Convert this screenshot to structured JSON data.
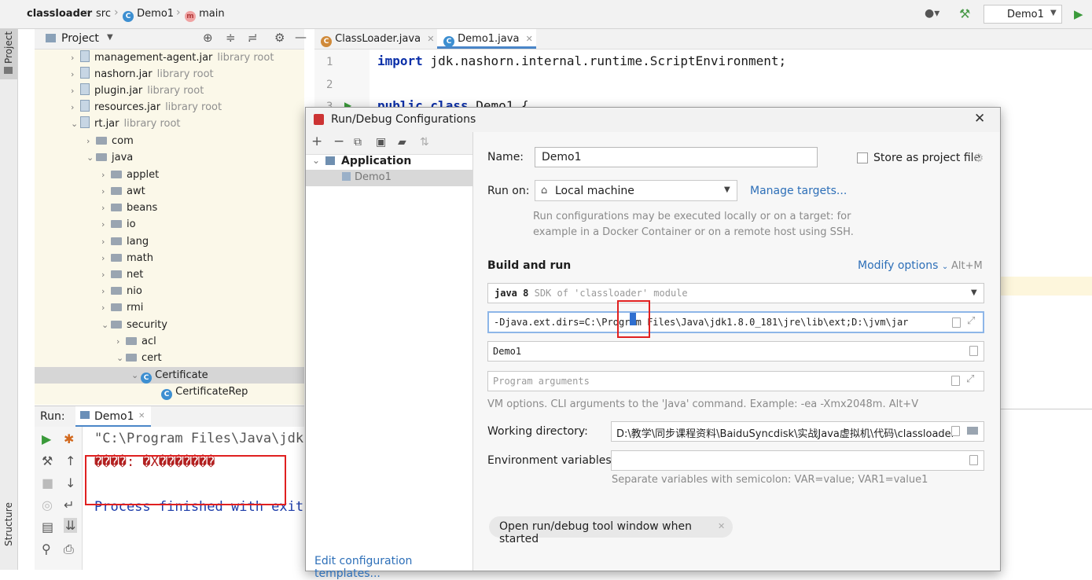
{
  "navbar": {
    "project": "classloader",
    "src": "src",
    "class_icon": "C",
    "demo": "Demo1",
    "method_icon": "m",
    "method": "main",
    "run_config": "Demo1"
  },
  "sidebar": {
    "project_label": "Project",
    "structure_label": "Structure"
  },
  "project_panel": {
    "title": "Project",
    "tree": [
      {
        "label": "management-agent.jar",
        "suffix": "library root"
      },
      {
        "label": "nashorn.jar",
        "suffix": "library root"
      },
      {
        "label": "plugin.jar",
        "suffix": "library root"
      },
      {
        "label": "resources.jar",
        "suffix": "library root"
      },
      {
        "label": "rt.jar",
        "suffix": "library root"
      },
      {
        "label": "com"
      },
      {
        "label": "java"
      },
      {
        "label": "applet"
      },
      {
        "label": "awt"
      },
      {
        "label": "beans"
      },
      {
        "label": "io"
      },
      {
        "label": "lang"
      },
      {
        "label": "math"
      },
      {
        "label": "net"
      },
      {
        "label": "nio"
      },
      {
        "label": "rmi"
      },
      {
        "label": "security"
      },
      {
        "label": "acl"
      },
      {
        "label": "cert"
      },
      {
        "label": "Certificate"
      },
      {
        "label": "CertificateRep"
      }
    ]
  },
  "editor": {
    "tabs": [
      {
        "label": "ClassLoader.java"
      },
      {
        "label": "Demo1.java"
      }
    ],
    "line_numbers": [
      "1",
      "2",
      "3"
    ],
    "line1_kw": "import",
    "line1_rest": " jdk.nashorn.internal.runtime.ScriptEnvironment;",
    "line3_kw": "public class",
    "line3_rest": " Demo1 {"
  },
  "run_panel": {
    "label": "Run:",
    "tab": "Demo1",
    "console_lines": [
      "\"C:\\Program Files\\Java\\jdk",
      "����: �X�������",
      "",
      "Process finished with exit"
    ]
  },
  "dialog": {
    "title": "Run/Debug Configurations",
    "tree_group": "Application",
    "tree_item": "Demo1",
    "edit_templates": "Edit configuration templates...",
    "name_label": "Name:",
    "name_value": "Demo1",
    "store_label": "Store as project file",
    "run_on_label": "Run on:",
    "run_on_value": "Local machine",
    "manage_targets": "Manage targets...",
    "run_on_hint_1": "Run configurations may be executed locally or on a target: for",
    "run_on_hint_2": "example in a Docker Container or on a remote host using SSH.",
    "build_run_heading": "Build and run",
    "modify_options": "Modify options",
    "modify_shortcut": "Alt+M",
    "jdk_bold": "java 8",
    "jdk_hint": "SDK of 'classloader' module",
    "vm_options": "-Djava.ext.dirs=C:\\Program Files\\Java\\jdk1.8.0_181\\jre\\lib\\ext;D:\\jvm\\jar",
    "main_class": "Demo1",
    "program_args_placeholder": "Program arguments",
    "vm_hint": "VM options. CLI arguments to the 'Java' command. Example: -ea -Xmx2048m. Alt+V",
    "working_dir_label": "Working directory:",
    "working_dir_value": "D:\\教学\\同步课程资料\\BaiduSyncdisk\\实战Java虚拟机\\代码\\classloader",
    "env_label": "Environment variables:",
    "env_hint": "Separate variables with semicolon: VAR=value; VAR1=value1",
    "open_window_chip": "Open run/debug tool window when started"
  },
  "colors": {
    "highlight_box": "#e02020",
    "link": "#2d6fb8",
    "tree_bg": "#fbf8e9",
    "run_green": "#3a9a3a"
  }
}
